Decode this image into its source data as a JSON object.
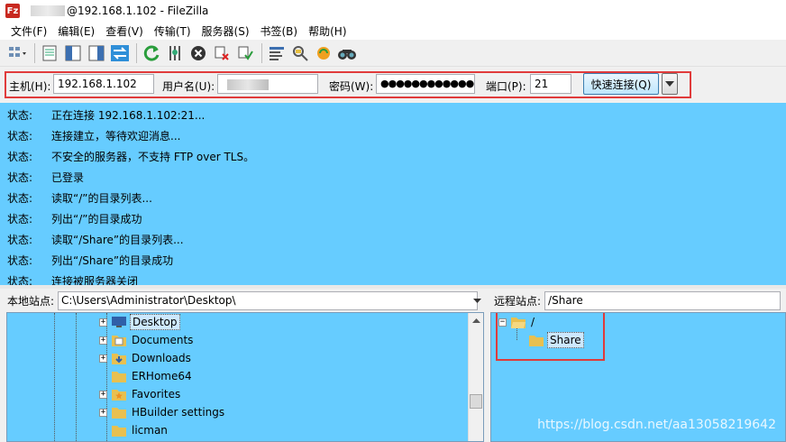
{
  "window": {
    "title": "@192.168.1.102 - FileZilla",
    "app_icon_letter": "Fz"
  },
  "menu": [
    "文件(F)",
    "编辑(E)",
    "查看(V)",
    "传输(T)",
    "服务器(S)",
    "书签(B)",
    "帮助(H)"
  ],
  "toolbar": {
    "icons": [
      "site-manager-icon",
      "toggle-log-icon",
      "toggle-local-tree-icon",
      "toggle-remote-tree-icon",
      "transfer-queue-icon",
      "refresh-icon",
      "process-queue-icon",
      "cancel-icon",
      "disconnect-icon",
      "reconnect-icon",
      "filter-icon",
      "compare-icon",
      "sync-browse-icon",
      "search-icon"
    ]
  },
  "quickconnect": {
    "host_label": "主机(H):",
    "host_value": "192.168.1.102",
    "user_label": "用户名(U):",
    "pass_label": "密码(W):",
    "pass_value": "●●●●●●●●●●●●",
    "port_label": "端口(P):",
    "port_value": "21",
    "button_label": "快速连接(Q)"
  },
  "log": [
    {
      "key": "状态:",
      "msg": "正在连接 192.168.1.102:21..."
    },
    {
      "key": "状态:",
      "msg": "连接建立，等待欢迎消息..."
    },
    {
      "key": "状态:",
      "msg": "不安全的服务器，不支持 FTP over TLS。"
    },
    {
      "key": "状态:",
      "msg": "已登录"
    },
    {
      "key": "状态:",
      "msg": "读取“/”的目录列表..."
    },
    {
      "key": "状态:",
      "msg": "列出“/”的目录成功"
    },
    {
      "key": "状态:",
      "msg": "读取“/Share”的目录列表..."
    },
    {
      "key": "状态:",
      "msg": "列出“/Share”的目录成功"
    },
    {
      "key": "状态:",
      "msg": "连接被服务器关闭"
    }
  ],
  "local": {
    "label": "本地站点:",
    "path": "C:\\Users\\Administrator\\Desktop\\",
    "items": [
      "Desktop",
      "Documents",
      "Downloads",
      "ERHome64",
      "Favorites",
      "HBuilder settings",
      "licman"
    ]
  },
  "remote": {
    "label": "远程站点:",
    "path": "/Share",
    "root": "/",
    "child": "Share"
  },
  "watermark": "https://blog.csdn.net/aa13058219642",
  "colors": {
    "log_bg": "#66ccff",
    "highlight_outline": "#e03b3b"
  }
}
